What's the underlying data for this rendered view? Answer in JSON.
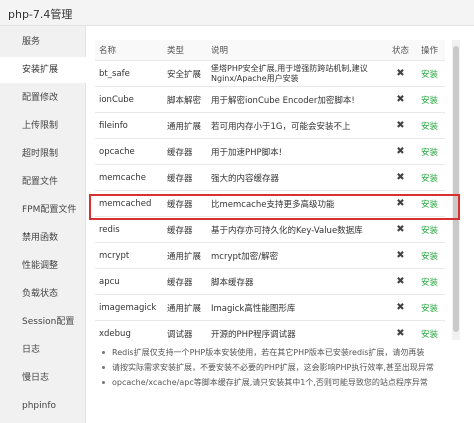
{
  "window": {
    "title": "php-7.4管理"
  },
  "sidebar": {
    "items": [
      {
        "label": "服务"
      },
      {
        "label": "安装扩展"
      },
      {
        "label": "配置修改"
      },
      {
        "label": "上传限制"
      },
      {
        "label": "超时限制"
      },
      {
        "label": "配置文件"
      },
      {
        "label": "FPM配置文件"
      },
      {
        "label": "禁用函数"
      },
      {
        "label": "性能调整"
      },
      {
        "label": "负载状态"
      },
      {
        "label": "Session配置"
      },
      {
        "label": "日志"
      },
      {
        "label": "慢日志"
      },
      {
        "label": "phpinfo"
      }
    ],
    "active_index": 1
  },
  "table": {
    "headers": {
      "name": "名称",
      "type": "类型",
      "desc": "说明",
      "status": "状态",
      "op": "操作"
    },
    "rows": [
      {
        "name": "bt_safe",
        "type": "安全扩展",
        "desc": "堡塔PHP安全扩展,用于增强防跨站机制,建议Nginx/Apache用户安装",
        "status": "✖",
        "op": "安装"
      },
      {
        "name": "ionCube",
        "type": "脚本解密",
        "desc": "用于解密ionCube Encoder加密脚本!",
        "status": "✖",
        "op": "安装"
      },
      {
        "name": "fileinfo",
        "type": "通用扩展",
        "desc": "若可用内存小于1G，可能会安装不上",
        "status": "✖",
        "op": "安装"
      },
      {
        "name": "opcache",
        "type": "缓存器",
        "desc": "用于加速PHP脚本!",
        "status": "✖",
        "op": "安装"
      },
      {
        "name": "memcache",
        "type": "缓存器",
        "desc": "强大的内容缓存器",
        "status": "✖",
        "op": "安装"
      },
      {
        "name": "memcached",
        "type": "缓存器",
        "desc": "比memcache支持更多高级功能",
        "status": "✖",
        "op": "安装"
      },
      {
        "name": "redis",
        "type": "缓存器",
        "desc": "基于内存亦可持久化的Key-Value数据库",
        "status": "✖",
        "op": "安装"
      },
      {
        "name": "mcrypt",
        "type": "通用扩展",
        "desc": "mcrypt加密/解密",
        "status": "✖",
        "op": "安装"
      },
      {
        "name": "apcu",
        "type": "缓存器",
        "desc": "脚本缓存器",
        "status": "✖",
        "op": "安装"
      },
      {
        "name": "imagemagick",
        "type": "通用扩展",
        "desc": "Imagick高性能图形库",
        "status": "✖",
        "op": "安装"
      },
      {
        "name": "xdebug",
        "type": "调试器",
        "desc": "开源的PHP程序调试器",
        "status": "✖",
        "op": "安装"
      }
    ]
  },
  "notes": [
    "Redis扩展仅支持一个PHP版本安装使用，若在其它PHP版本已安装redis扩展，请勿再装",
    "请按实际需求安装扩展，不要安装不必要的PHP扩展，这会影响PHP执行效率,甚至出现异常",
    "opcache/xcache/apc等脚本缓存扩展,请只安装其中1个,否则可能导致您的站点程序异常"
  ],
  "colors": {
    "install_green": "#20a53a",
    "highlight_red": "#d9312f"
  }
}
